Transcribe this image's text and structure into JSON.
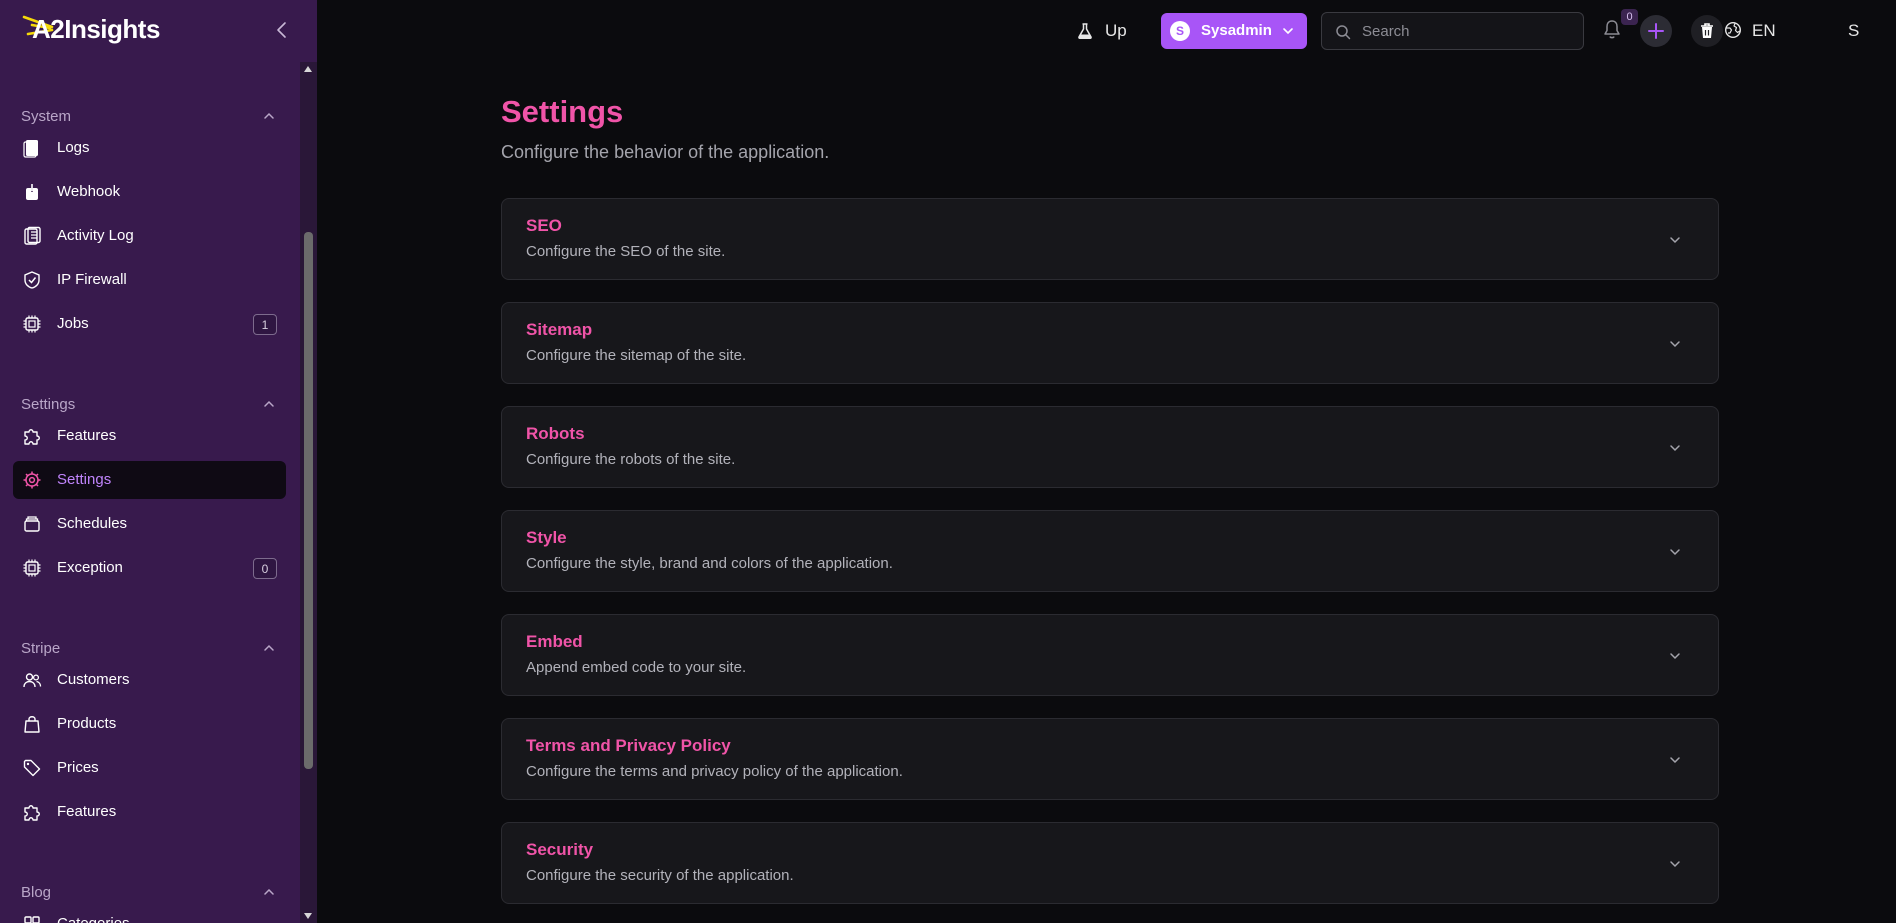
{
  "brand": {
    "name": "A2Insights"
  },
  "colors": {
    "sidebar_bg": "#381a4d",
    "accent_pink": "#f054a8",
    "accent_purple": "#a855f7",
    "page_bg": "#0b0b0e"
  },
  "sidebar": {
    "groups": [
      {
        "label": "System",
        "items": [
          {
            "label": "Logs",
            "icon": "document-icon"
          },
          {
            "label": "Webhook",
            "icon": "webhook-icon"
          },
          {
            "label": "Activity Log",
            "icon": "clipboard-list-icon"
          },
          {
            "label": "IP Firewall",
            "icon": "shield-check-icon"
          },
          {
            "label": "Jobs",
            "icon": "cpu-chip-icon",
            "badge": "1"
          }
        ]
      },
      {
        "label": "Settings",
        "items": [
          {
            "label": "Features",
            "icon": "puzzle-icon"
          },
          {
            "label": "Settings",
            "icon": "cog-icon",
            "active": true
          },
          {
            "label": "Schedules",
            "icon": "stack-icon"
          },
          {
            "label": "Exception",
            "icon": "cpu-chip-icon",
            "badge": "0"
          }
        ]
      },
      {
        "label": "Stripe",
        "items": [
          {
            "label": "Customers",
            "icon": "users-icon"
          },
          {
            "label": "Products",
            "icon": "shopping-bag-icon"
          },
          {
            "label": "Prices",
            "icon": "tag-icon"
          },
          {
            "label": "Features",
            "icon": "puzzle-icon"
          }
        ]
      },
      {
        "label": "Blog",
        "items": [
          {
            "label": "Categories",
            "icon": "grid-icon"
          }
        ]
      }
    ]
  },
  "topbar": {
    "up_label": "Up",
    "user_label": "Sysadmin",
    "user_initial": "S",
    "search_placeholder": "Search",
    "notification_count": "0",
    "language": "EN",
    "profile_initial": "S"
  },
  "page": {
    "title": "Settings",
    "subtitle": "Configure the behavior of the application.",
    "sections": [
      {
        "title": "SEO",
        "description": "Configure the SEO of the site."
      },
      {
        "title": "Sitemap",
        "description": "Configure the sitemap of the site."
      },
      {
        "title": "Robots",
        "description": "Configure the robots of the site."
      },
      {
        "title": "Style",
        "description": "Configure the style, brand and colors of the application."
      },
      {
        "title": "Embed",
        "description": "Append embed code to your site."
      },
      {
        "title": "Terms and Privacy Policy",
        "description": "Configure the terms and privacy policy of the application."
      },
      {
        "title": "Security",
        "description": "Configure the security of the application."
      }
    ]
  }
}
